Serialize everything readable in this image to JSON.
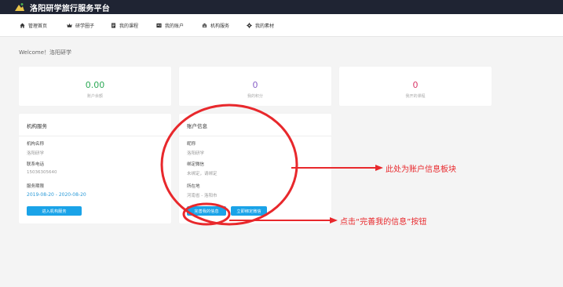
{
  "header": {
    "title": "洛阳研学旅行服务平台"
  },
  "nav": {
    "items": [
      {
        "label": "管理首页",
        "icon": "home-icon"
      },
      {
        "label": "研学圈子",
        "icon": "crown-icon"
      },
      {
        "label": "我的课程",
        "icon": "document-icon"
      },
      {
        "label": "我的账户",
        "icon": "id-card-icon"
      },
      {
        "label": "机构服务",
        "icon": "building-icon"
      },
      {
        "label": "我的素材",
        "icon": "gear-icon"
      }
    ]
  },
  "welcome": "Welcome！洛阳研学",
  "stats": [
    {
      "value": "0.00",
      "label": "账户余额",
      "color": "#2eaa57"
    },
    {
      "value": "0",
      "label": "我的积分",
      "color": "#8a63c8"
    },
    {
      "value": "0",
      "label": "我开的课程",
      "color": "#d93a6a"
    }
  ],
  "org_card": {
    "title": "机构服务",
    "fields": [
      {
        "key": "机构名称",
        "value": "洛阳研学"
      },
      {
        "key": "联系电话",
        "value": "15036305640"
      },
      {
        "key": "服务期限",
        "value": "2019-08-20 - 2020-08-20"
      }
    ],
    "button": "进入机构服务"
  },
  "account_card": {
    "title": "账户信息",
    "fields": [
      {
        "key": "昵称",
        "value": "洛阳研学"
      },
      {
        "key": "绑定微信",
        "value": "未绑定，请绑定"
      },
      {
        "key": "所在地",
        "value": "河南省 - 洛阳市"
      }
    ],
    "button_complete": "完善我的信息",
    "button_bind": "立即绑定微信"
  },
  "annotations": {
    "account_block": "此处为账户信息板块",
    "click_complete": "点击“完善我的信息”按钮",
    "color": "#e8282c"
  }
}
